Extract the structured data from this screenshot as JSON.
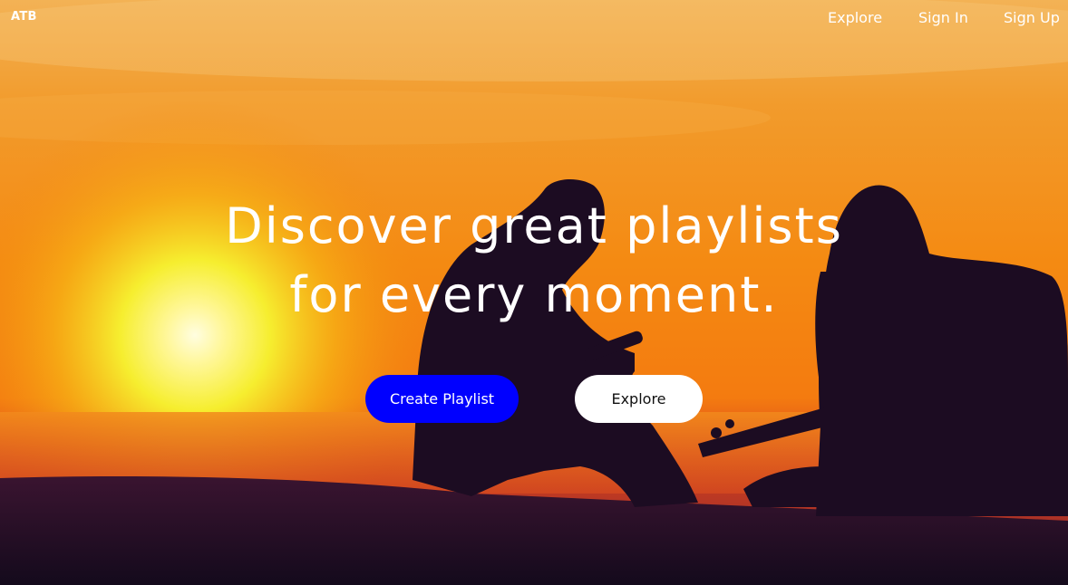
{
  "nav": {
    "logo": "ATB",
    "links": [
      {
        "label": "Explore"
      },
      {
        "label": "Sign In"
      },
      {
        "label": "Sign Up"
      }
    ]
  },
  "hero": {
    "headline_line1": "Discover great playlists",
    "headline_line2": "for every moment.",
    "background": "sunset-guitarists-photo",
    "buttons": {
      "create_label": "Create Playlist",
      "explore_label": "Explore"
    }
  },
  "colors": {
    "primary_button": "#0000ff",
    "secondary_button": "#ffffff",
    "text": "#ffffff"
  }
}
